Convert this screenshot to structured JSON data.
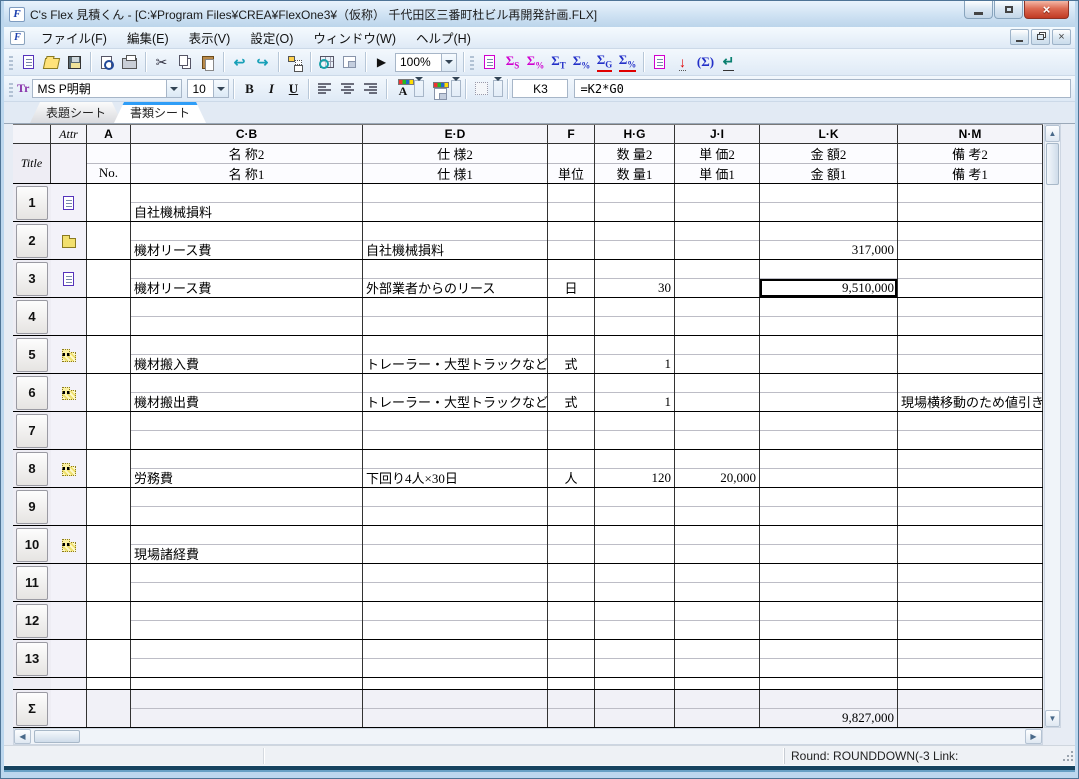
{
  "window": {
    "title": "C's Flex 見積くん - [C:¥Program Files¥CREA¥FlexOne3¥（仮称） 千代田区三番町杜ビル再開発計画.FLX]",
    "app_initial": "F"
  },
  "menu": {
    "items": [
      "ファイル(F)",
      "編集(E)",
      "表示(V)",
      "設定(O)",
      "ウィンドウ(W)",
      "ヘルプ(H)"
    ]
  },
  "toolbar": {
    "zoom_value": "100%",
    "sum_buttons": [
      {
        "sym": "Σ",
        "sub": "S",
        "color": "#d000d0",
        "underline": false
      },
      {
        "sym": "Σ",
        "sub": "%",
        "color": "#d000d0",
        "underline": false
      },
      {
        "sym": "Σ",
        "sub": "T",
        "color": "#2330c8",
        "underline": false
      },
      {
        "sym": "Σ",
        "sub": "%",
        "color": "#2330c8",
        "underline": false
      },
      {
        "sym": "Σ",
        "sub": "G",
        "color": "#2330c8",
        "underline": true
      },
      {
        "sym": "Σ",
        "sub": "%",
        "color": "#2330c8",
        "underline": true
      }
    ]
  },
  "format": {
    "tt_badge": "Tr",
    "font_name": "MS P明朝",
    "font_size": "10",
    "bold": "B",
    "italic": "I",
    "underline": "U",
    "color_letter": "A"
  },
  "formula_bar": {
    "cell_ref": "K3",
    "formula": "=K2*G0"
  },
  "sheet_tabs": [
    {
      "label": "表題シート",
      "active": false
    },
    {
      "label": "書類シート",
      "active": true
    }
  ],
  "glyphs": {
    "cut": "✂",
    "nav_back": "↩",
    "nav_forward": "↪",
    "run": "▶",
    "down_arrow": "↓",
    "sum_paren": "(Σ)",
    "return_arrow": "↵",
    "close": "×",
    "scroll_up": "▲",
    "scroll_down": "▼",
    "scroll_left": "◀",
    "scroll_right": "▶"
  },
  "grid": {
    "corner_title": "Title",
    "headers": {
      "attr": "Attr",
      "a": "A",
      "cb": "C·B",
      "ed": "E·D",
      "f": "F",
      "hg": "H·G",
      "ji": "J·I",
      "lk": "L·K",
      "nm": "N·M"
    },
    "sub2": {
      "cb": "名 称2",
      "ed": "仕 様2",
      "hg": "数 量2",
      "ji": "単 価2",
      "lk": "金 額2",
      "nm": "備 考2"
    },
    "sub1": {
      "a": "No.",
      "cb": "名 称1",
      "ed": "仕 様1",
      "f": "単位",
      "hg": "数 量1",
      "ji": "単 価1",
      "lk": "金 額1",
      "nm": "備 考1"
    },
    "rows": [
      {
        "num": "1",
        "icon": "document",
        "name1": "自社機械損料"
      },
      {
        "num": "2",
        "icon": "folder",
        "name1": "機材リース費",
        "spec1": "自社機械損料",
        "amount1": "317,000"
      },
      {
        "num": "3",
        "icon": "document",
        "name1": "機材リース費",
        "spec1": "外部業者からのリース",
        "unit": "日",
        "qty1": "30",
        "amount1": "9,510,000",
        "selected": "amount1"
      },
      {
        "num": "4"
      },
      {
        "num": "5",
        "icon": "folder-light",
        "name1": "機材搬入費",
        "spec1": "トレーラー・大型トラックなど",
        "unit": "式",
        "qty1": "1"
      },
      {
        "num": "6",
        "icon": "folder-light",
        "name1": "機材搬出費",
        "spec1": "トレーラー・大型トラックなど",
        "unit": "式",
        "qty1": "1",
        "note1": "現場横移動のため値引き"
      },
      {
        "num": "7"
      },
      {
        "num": "8",
        "icon": "folder-light",
        "name1": "労務費",
        "spec1": "下回り4人×30日",
        "unit": "人",
        "qty1": "120",
        "price1": "20,000"
      },
      {
        "num": "9"
      },
      {
        "num": "10",
        "icon": "folder-light",
        "name1": "現場諸経費"
      },
      {
        "num": "11"
      },
      {
        "num": "12"
      },
      {
        "num": "13"
      }
    ],
    "sum_row": {
      "label": "Σ",
      "amount1": "9,827,000"
    }
  },
  "status_bar": {
    "right_text": "Round: ROUNDDOWN(-3 Link:"
  }
}
